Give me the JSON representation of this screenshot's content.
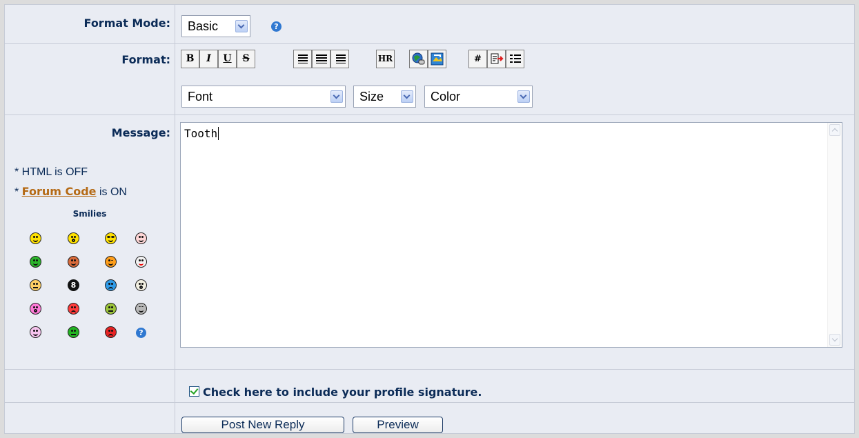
{
  "labels": {
    "format_mode": "Format Mode:",
    "format": "Format:",
    "message": "Message:"
  },
  "format_mode": {
    "selected": "Basic"
  },
  "toolbar": {
    "bold": "B",
    "italic": "I",
    "underline": "U",
    "strike": "S",
    "hr": "HR",
    "hash": "#"
  },
  "dropdowns": {
    "font": "Font",
    "size": "Size",
    "color": "Color"
  },
  "message": {
    "text": "Tooth"
  },
  "notes": {
    "html_prefix": "* HTML is OFF",
    "forum_prefix": "* ",
    "forum_link": "Forum Code",
    "forum_suffix": " is ON"
  },
  "smilies": {
    "title": "Smilies",
    "eightball": "8",
    "help": "?"
  },
  "signature": {
    "label": "Check here to include your profile signature.",
    "checked": true
  },
  "buttons": {
    "post": "Post New Reply",
    "preview": "Preview"
  },
  "colors": {
    "background": "#e9ecf3",
    "text": "#0b2b57",
    "link": "#b56a15"
  }
}
